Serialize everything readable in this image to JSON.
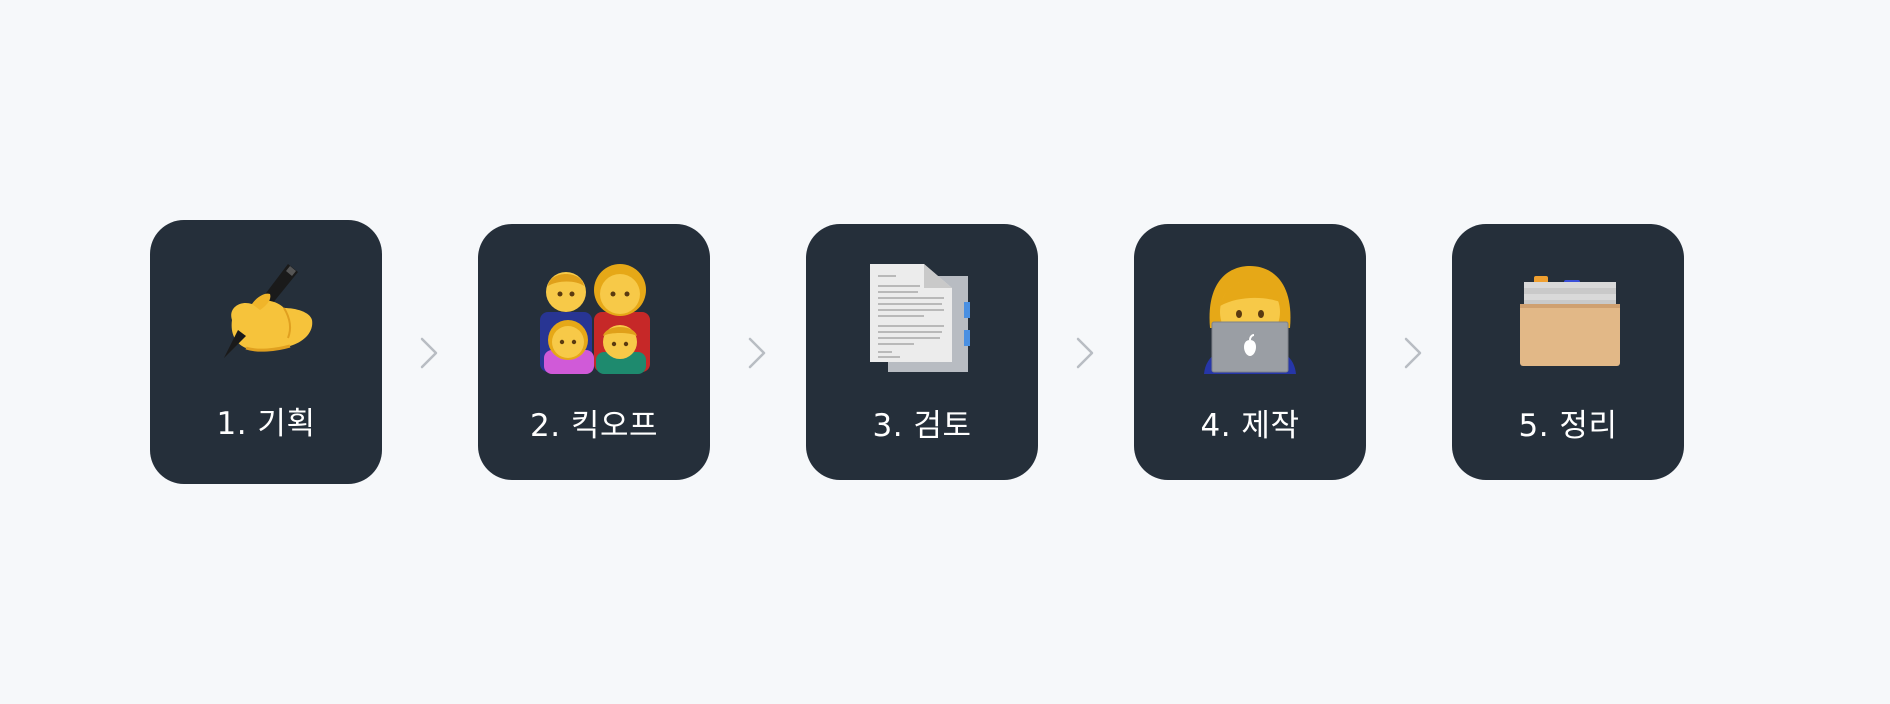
{
  "steps": [
    {
      "label": "1. 기획",
      "icon": "writing-hand-icon"
    },
    {
      "label": "2. 킥오프",
      "icon": "family-icon"
    },
    {
      "label": "3. 검토",
      "icon": "documents-icon"
    },
    {
      "label": "4. 제작",
      "icon": "woman-at-laptop-icon"
    },
    {
      "label": "5. 정리",
      "icon": "card-file-box-icon"
    }
  ],
  "connector_icon": "chevron-right-icon",
  "colors": {
    "background": "#f6f8fa",
    "card": "#252f3a",
    "label": "#ffffff",
    "chevron": "#b8bdc3"
  }
}
